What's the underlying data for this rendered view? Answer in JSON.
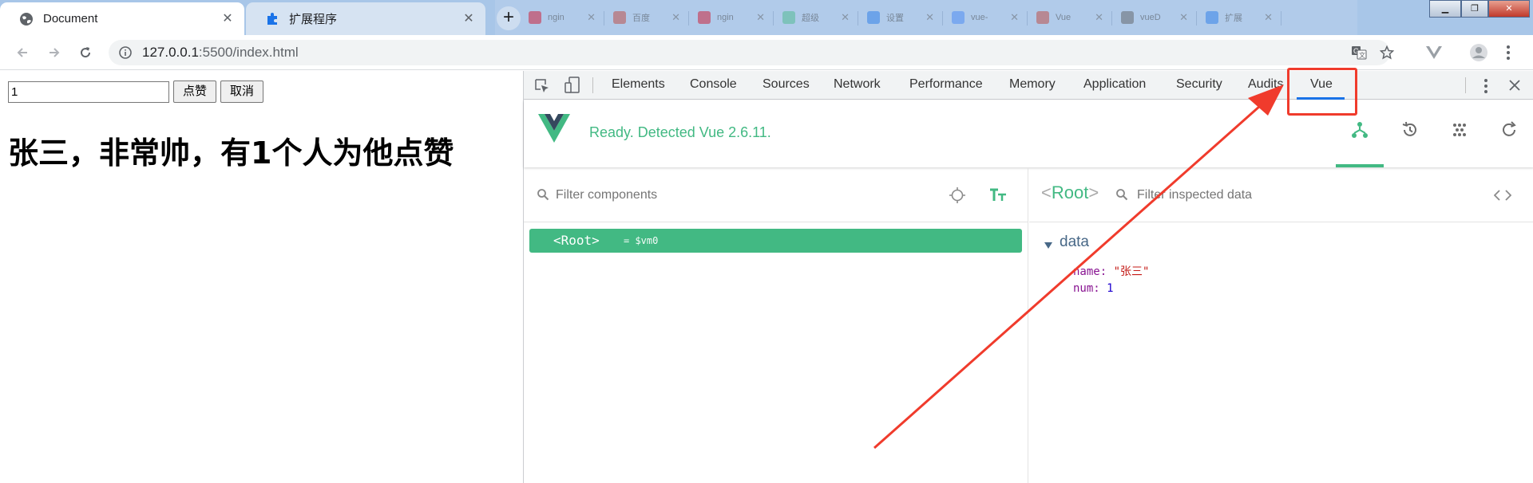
{
  "browser": {
    "active_tab": {
      "title": "Document"
    },
    "second_tab": {
      "title": "扩展程序"
    },
    "background_tabs": [
      {
        "title": "ngin",
        "color": "#d0021b"
      },
      {
        "title": "百度",
        "color": "#c0392b"
      },
      {
        "title": "ngin",
        "color": "#d0021b"
      },
      {
        "title": "超级",
        "color": "#42b983"
      },
      {
        "title": "设置",
        "color": "#1a73e8"
      },
      {
        "title": "vue-",
        "color": "#3b82f6"
      },
      {
        "title": "Vue",
        "color": "#c0392b"
      },
      {
        "title": "vueD",
        "color": "#555555"
      },
      {
        "title": "扩展",
        "color": "#1a73e8"
      }
    ],
    "url": {
      "host": "127.0.0.1",
      "path": ":5500/index.html"
    }
  },
  "page": {
    "input_value": "1",
    "like_label": "点赞",
    "cancel_label": "取消",
    "heading": "张三，非常帅，有1个人为他点赞"
  },
  "devtools": {
    "tabs": [
      "Elements",
      "Console",
      "Sources",
      "Network",
      "Performance",
      "Memory",
      "Application",
      "Security",
      "Audits",
      "Vue"
    ],
    "selected_tab": "Vue",
    "vue": {
      "status": "Ready. Detected Vue 2.6.11.",
      "filter_components_placeholder": "Filter components",
      "root_tag": "<Root>",
      "root_vm": "= $vm0",
      "inspected_title": "Root",
      "filter_inspected_placeholder": "Filter inspected data",
      "data_section": "data",
      "props": [
        {
          "key": "name",
          "value": "\"张三\"",
          "kind": "string"
        },
        {
          "key": "num",
          "value": "1",
          "kind": "number"
        }
      ]
    }
  },
  "colors": {
    "vue_green": "#42b983",
    "annotation_red": "#f03b2c",
    "tab_underline": "#1a73e8"
  }
}
